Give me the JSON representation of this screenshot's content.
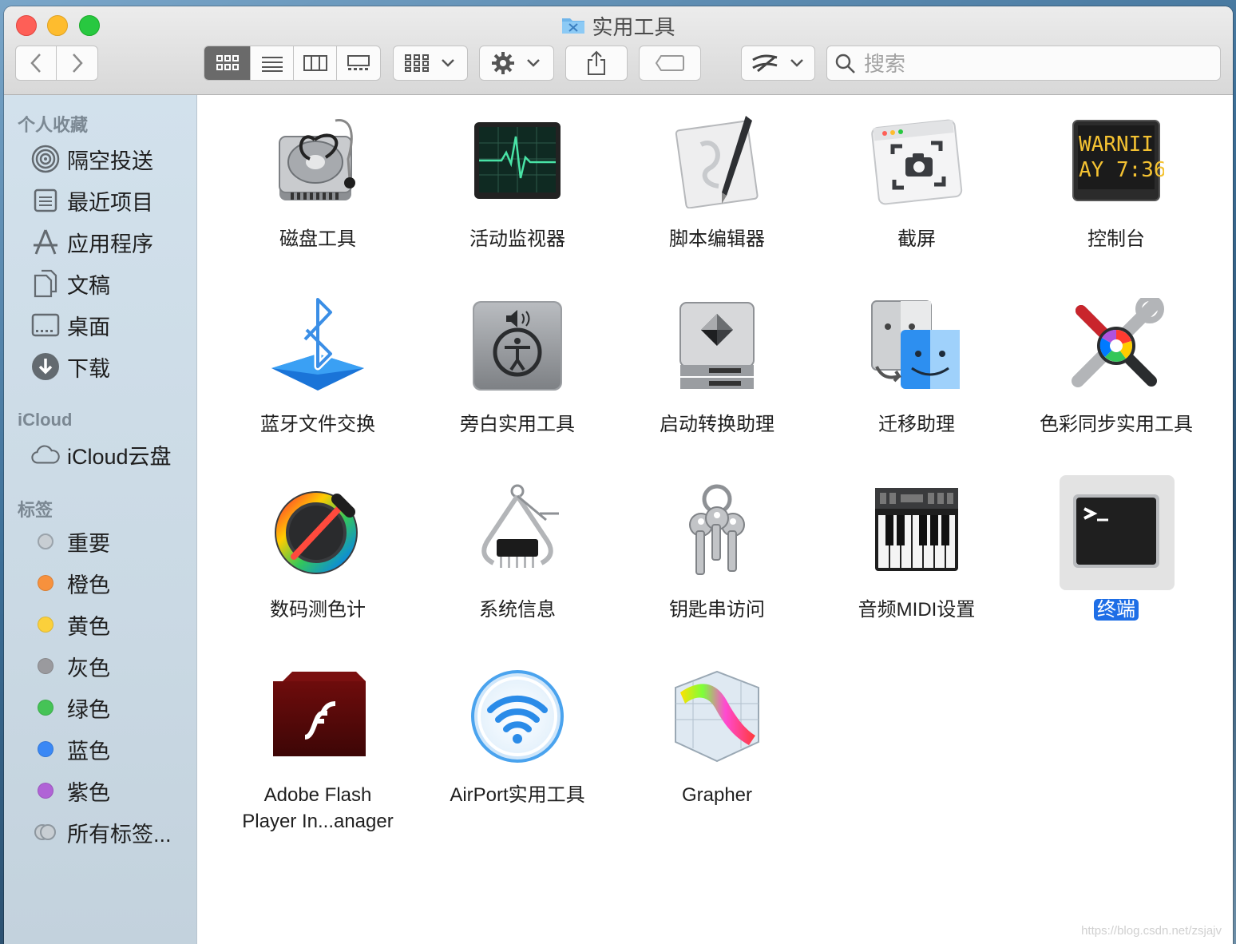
{
  "window": {
    "title": "实用工具"
  },
  "toolbar": {
    "search_placeholder": "搜索",
    "view_modes": [
      "icon-view",
      "list-view",
      "column-view",
      "gallery-view"
    ]
  },
  "sidebar": {
    "favorites_header": "个人收藏",
    "favorites": [
      {
        "label": "隔空投送",
        "icon": "airdrop-icon"
      },
      {
        "label": "最近项目",
        "icon": "recents-icon"
      },
      {
        "label": "应用程序",
        "icon": "applications-icon"
      },
      {
        "label": "文稿",
        "icon": "documents-icon"
      },
      {
        "label": "桌面",
        "icon": "desktop-icon"
      },
      {
        "label": "下载",
        "icon": "downloads-icon"
      }
    ],
    "icloud_header": "iCloud",
    "icloud": [
      {
        "label": "iCloud云盘",
        "icon": "cloud-icon"
      }
    ],
    "tags_header": "标签",
    "tags": [
      {
        "label": "重要",
        "color": "#c8ced3"
      },
      {
        "label": "橙色",
        "color": "#f7913d"
      },
      {
        "label": "黄色",
        "color": "#fbd03b"
      },
      {
        "label": "灰色",
        "color": "#9a9a9e"
      },
      {
        "label": "绿色",
        "color": "#45c356"
      },
      {
        "label": "蓝色",
        "color": "#3a88f5"
      },
      {
        "label": "紫色",
        "color": "#b063d6"
      },
      {
        "label": "所有标签...",
        "color": "#c8ced3"
      }
    ]
  },
  "apps": [
    {
      "name": "磁盘工具",
      "icon": "disk-utility-icon"
    },
    {
      "name": "活动监视器",
      "icon": "activity-monitor-icon"
    },
    {
      "name": "脚本编辑器",
      "icon": "script-editor-icon"
    },
    {
      "name": "截屏",
      "icon": "screenshot-icon"
    },
    {
      "name": "控制台",
      "icon": "console-icon",
      "console_text": [
        "WARNII",
        "AY 7:36"
      ]
    },
    {
      "name": "蓝牙文件交换",
      "icon": "bluetooth-icon"
    },
    {
      "name": "旁白实用工具",
      "icon": "voiceover-icon"
    },
    {
      "name": "启动转换助理",
      "icon": "boot-camp-icon"
    },
    {
      "name": "迁移助理",
      "icon": "migration-assistant-icon"
    },
    {
      "name": "色彩同步实用工具",
      "icon": "colorsync-icon"
    },
    {
      "name": "数码测色计",
      "icon": "color-meter-icon"
    },
    {
      "name": "系统信息",
      "icon": "system-information-icon"
    },
    {
      "name": "钥匙串访问",
      "icon": "keychain-icon"
    },
    {
      "name": "音频MIDI设置",
      "icon": "audio-midi-icon"
    },
    {
      "name": "终端",
      "icon": "terminal-icon",
      "selected": true
    },
    {
      "name": "Adobe Flash\nPlayer In...anager",
      "name_line1": "Adobe Flash",
      "name_line2": "Player In...anager",
      "icon": "flash-icon"
    },
    {
      "name": "AirPort实用工具",
      "icon": "airport-icon"
    },
    {
      "name": "Grapher",
      "icon": "grapher-icon"
    }
  ],
  "watermark": "https://blog.csdn.net/zsjajv"
}
